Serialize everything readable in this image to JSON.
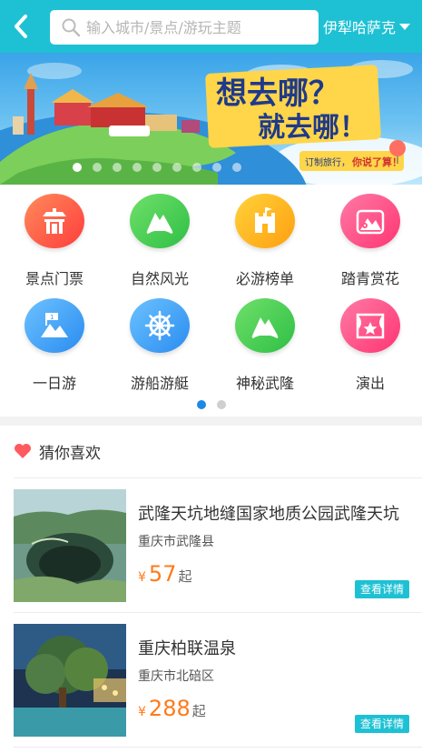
{
  "header": {
    "search_placeholder": "输入城市/景点/游玩主题",
    "city": "伊犁哈萨克"
  },
  "banner": {
    "headline_1": "想去哪？",
    "headline_2": "就去哪！",
    "tagline_1": "订制旅行，",
    "tagline_2": "你说了算！",
    "slide_count": 9,
    "active_slide": 1
  },
  "categories": [
    {
      "label": "景点门票",
      "icon": "gate-icon",
      "color": "#ff5a4a"
    },
    {
      "label": "自然风光",
      "icon": "mountain-icon",
      "color": "#3fcf5a"
    },
    {
      "label": "必游榜单",
      "icon": "castle-icon",
      "color": "#ffb418"
    },
    {
      "label": "踏青赏花",
      "icon": "flower-mountain-icon",
      "color": "#ff4f86"
    },
    {
      "label": "一日游",
      "icon": "flag-mountain-icon",
      "color": "#3aa3f5"
    },
    {
      "label": "游船游艇",
      "icon": "ship-wheel-icon",
      "color": "#3aa3f5"
    },
    {
      "label": "神秘武隆",
      "icon": "mountain-icon",
      "color": "#3fcf5a"
    },
    {
      "label": "演出",
      "icon": "stage-star-icon",
      "color": "#ff4f86"
    }
  ],
  "category_pages": 2,
  "category_active_page": 1,
  "recommend": {
    "title": "猜你喜欢",
    "items": [
      {
        "name": "武隆天坑地缝国家地质公园武隆天坑",
        "location": "重庆市武隆县",
        "currency": "¥",
        "price": "57",
        "suffix": "起",
        "button": "查看详情"
      },
      {
        "name": "重庆柏联温泉",
        "location": "重庆市北碚区",
        "currency": "¥",
        "price": "288",
        "suffix": "起",
        "button": "查看详情"
      }
    ]
  }
}
